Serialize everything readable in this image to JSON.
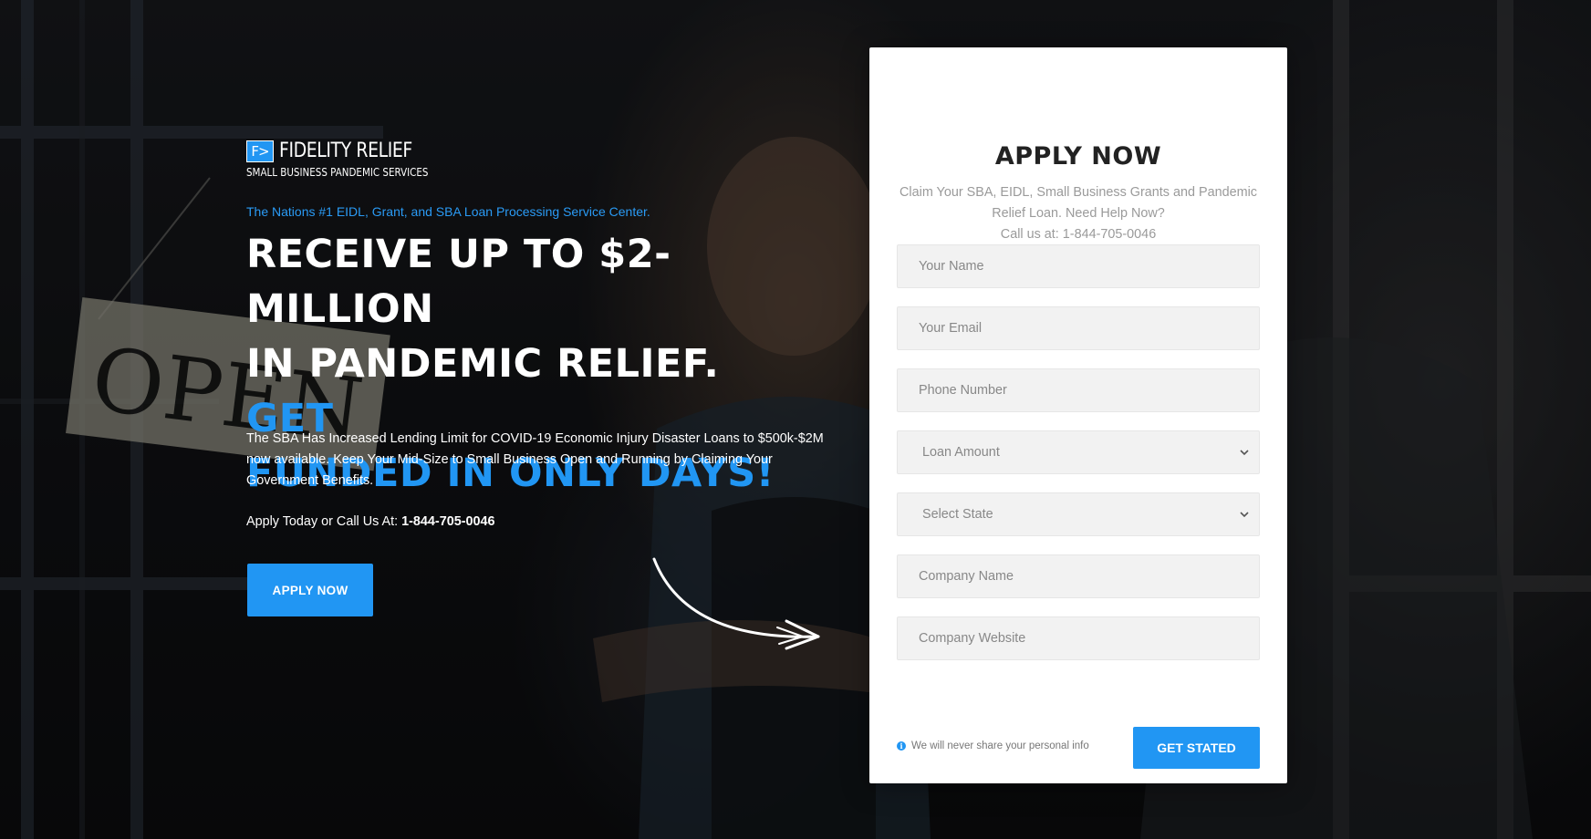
{
  "brand": {
    "logo_mark": "F>",
    "name": "FIDELITY RELIEF",
    "subtitle": "SMALL BUSINESS PANDEMIC SERVICES"
  },
  "hero": {
    "tagline": "The Nations #1 EIDL, Grant, and SBA Loan Processing Service Center.",
    "headline_line1": "RECEIVE UP TO $2-MILLION",
    "headline_line2": "IN PANDEMIC RELIEF.",
    "headline_accent_1": "GET",
    "headline_accent_2": "FUNDED IN ONLY DAYS!",
    "description": "The SBA Has Increased Lending Limit for COVID-19 Economic Injury Disaster Loans to $500k-$2M now available. Keep Your Mid-Size to Small Business Open and Running by Claiming Your Government Benefits.",
    "call_prefix": "Apply Today or Call Us At:",
    "call_phone": "1-844-705-0046",
    "cta_label": "APPLY NOW",
    "background_sign_text": "OPEN"
  },
  "form": {
    "title": "APPLY NOW",
    "subtitle_line1": "Claim Your SBA, EIDL, Small Business Grants and Pandemic",
    "subtitle_line2": "Relief Loan. Need Help Now?",
    "subtitle_line3": "Call us at: 1-844-705-0046",
    "fields": {
      "name_placeholder": "Your Name",
      "email_placeholder": "Your Email",
      "phone_placeholder": "Phone Number",
      "loan_amount_selected": "Loan Amount",
      "state_selected": "Select State",
      "company_name_placeholder": "Company Name",
      "company_website_placeholder": "Company Website"
    },
    "privacy_note": "We will never share your personal info",
    "submit_label": "GET STATED"
  },
  "colors": {
    "accent": "#2196f3",
    "card_background": "#ffffff",
    "field_background": "#f2f2f2"
  }
}
